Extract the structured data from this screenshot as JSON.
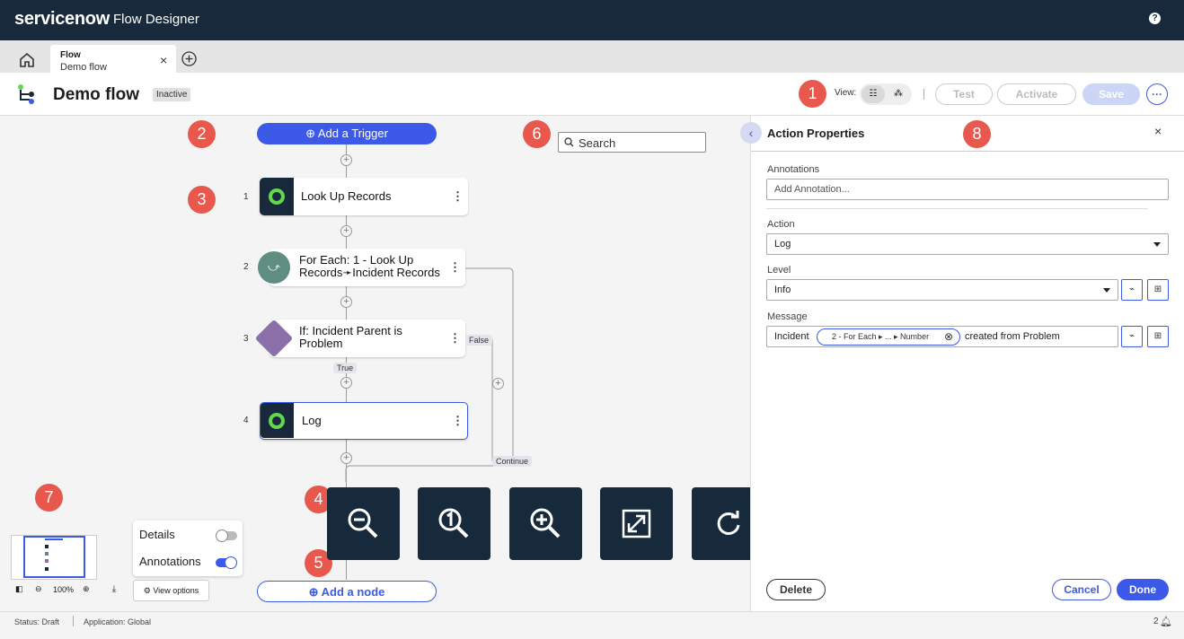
{
  "app": {
    "brand": "servicenow",
    "product": "Flow Designer",
    "help": "?"
  },
  "tabs": [
    {
      "type": "Flow",
      "name": "Demo flow",
      "close": "×"
    }
  ],
  "header": {
    "title": "Demo flow",
    "status": "Inactive",
    "view_label": "View:",
    "test": "Test",
    "activate": "Activate",
    "save": "Save",
    "more": "···"
  },
  "markers": [
    "1",
    "2",
    "3",
    "4",
    "5",
    "6",
    "7",
    "8"
  ],
  "canvas": {
    "trigger": "Add a Trigger",
    "search_placeholder": "Search",
    "steps": [
      {
        "num": "1",
        "label": "Look Up Records",
        "icon": "lookup-icon"
      },
      {
        "num": "2",
        "label": "For Each: 1 - Look Up Records➛Incident Records",
        "icon": "foreach-icon"
      },
      {
        "num": "3",
        "label": "If: Incident Parent is Problem",
        "icon": "if-icon"
      },
      {
        "num": "4",
        "label": "Log",
        "icon": "log-icon"
      }
    ],
    "branch_false": "False",
    "branch_true": "True",
    "branch_continue": "Continue",
    "add_node": "Add a node",
    "zoom_controls": [
      "zoom-out-icon",
      "zoom-reset-icon",
      "zoom-in-icon",
      "fit-screen-icon",
      "redo-icon",
      "undo-icon"
    ]
  },
  "minimap": {
    "zoom": "100%",
    "options": {
      "details": "Details",
      "annotations": "Annotations",
      "view_options": "View options"
    }
  },
  "panel": {
    "title": "Action Properties",
    "annotations_label": "Annotations",
    "annotations_placeholder": "Add Annotation...",
    "action_label": "Action",
    "action_value": "Log",
    "level_label": "Level",
    "level_value": "Info",
    "message_label": "Message",
    "message_prefix": "Incident",
    "message_pill": "2 - For Each ▸ ... ▸ Number",
    "message_suffix": "created from Problem",
    "delete": "Delete",
    "cancel": "Cancel",
    "done": "Done"
  },
  "status": {
    "status": "Status: Draft",
    "application": "Application: Global",
    "notif": "2"
  },
  "colors": {
    "accent": "#3c59e7",
    "dark": "#17293a",
    "marker": "#e8584c"
  }
}
